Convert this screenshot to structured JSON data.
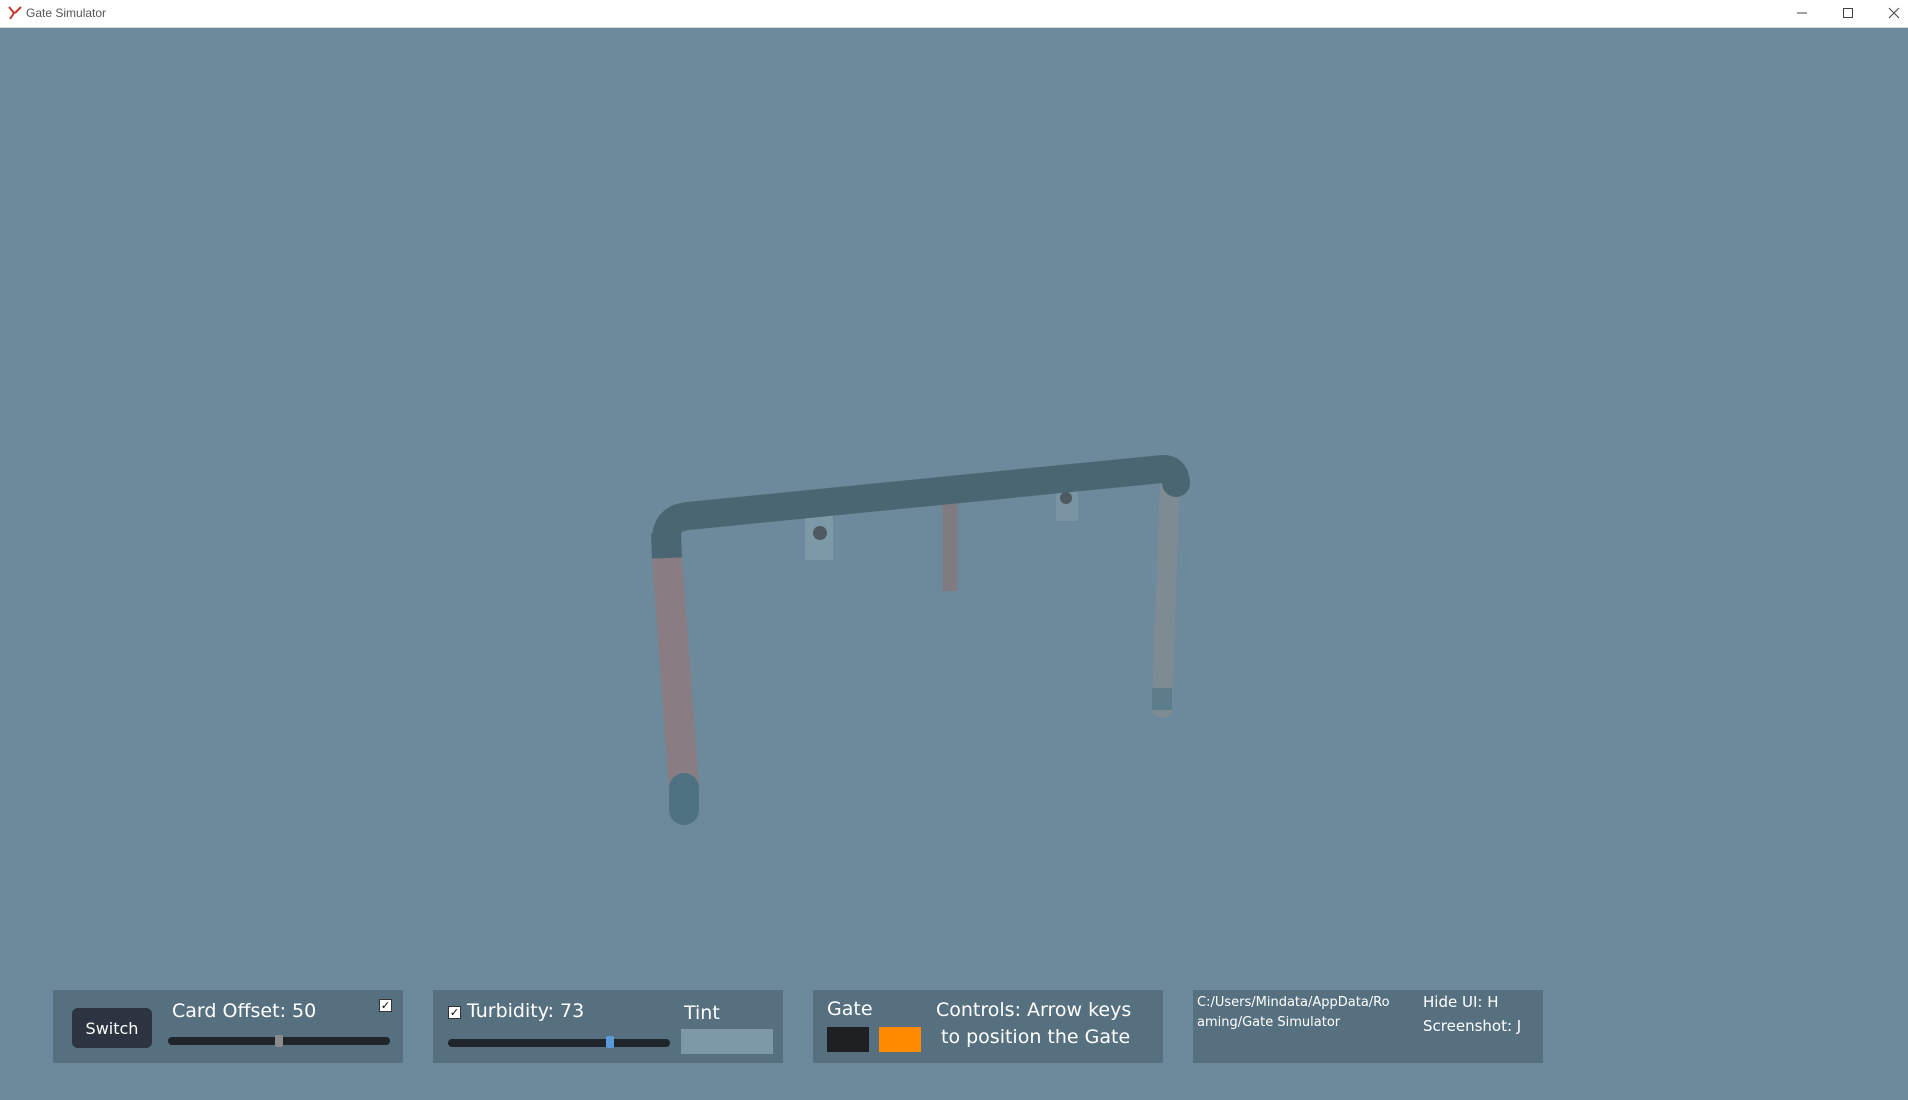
{
  "window": {
    "title": "Gate Simulator"
  },
  "card_panel": {
    "switch_label": "Switch",
    "card_offset_label": "Card Offset: 50",
    "card_offset_value": 50,
    "card_offset_max": 100,
    "checkbox_checked": true
  },
  "turbidity_panel": {
    "turbidity_label": "Turbidity: 73",
    "turbidity_value": 73,
    "turbidity_max": 100,
    "checkbox_checked": true,
    "tint_label": "Tint"
  },
  "gate_panel": {
    "gate_label": "Gate",
    "gate_colors": [
      "#1e2024",
      "#ff8a00"
    ],
    "controls_line1": "Controls: Arrow keys",
    "controls_line2": "to position the Gate"
  },
  "info_panel": {
    "path_line1": "C:/Users/Mindata/AppData/Ro",
    "path_line2": "aming/Gate Simulator",
    "hide_ui": "Hide UI: H",
    "screenshot": "Screenshot: J"
  },
  "colors": {
    "background": "#6c8a9b",
    "panel": "#56707f",
    "gate_bar": "#4b6673",
    "gate_post": "#8a7c83",
    "slider_thumb_card": "#8a8a8a",
    "slider_thumb_turbidity": "#5b9ad8"
  }
}
